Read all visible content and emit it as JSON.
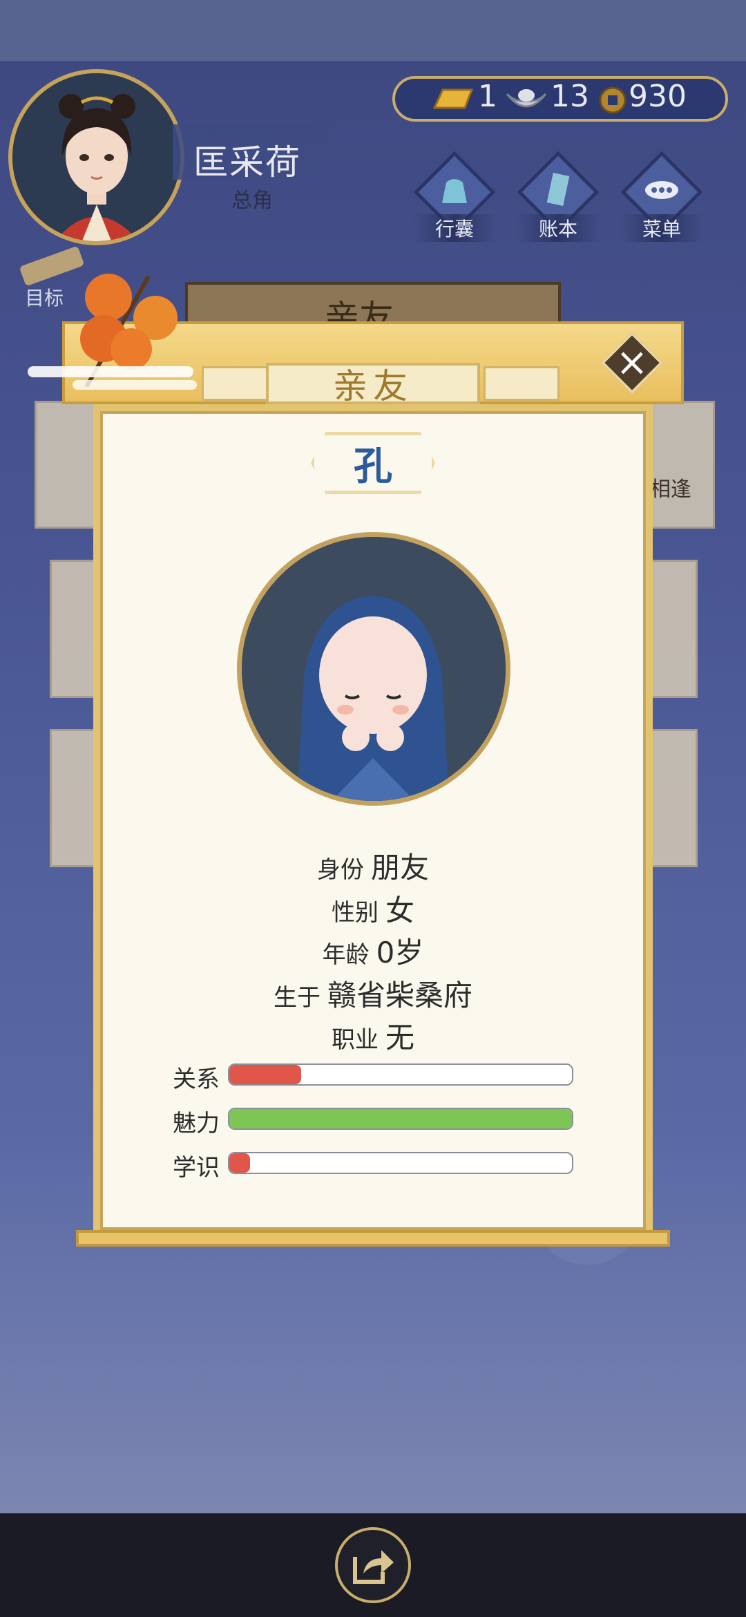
{
  "player": {
    "name": "匡采荷",
    "role": "总角"
  },
  "currency": {
    "gold": "1",
    "silver": "13",
    "coins": "930"
  },
  "menu": [
    {
      "label": "行囊",
      "icon": "bag-icon"
    },
    {
      "label": "账本",
      "icon": "ledger-icon"
    },
    {
      "label": "菜单",
      "icon": "more-icon"
    }
  ],
  "goal_label": "目标",
  "background_banner": "亲友",
  "background_card_text": "相逢",
  "modal": {
    "title": "亲友",
    "surname": "孔",
    "info": [
      {
        "key": "身份",
        "value": "朋友"
      },
      {
        "key": "性别",
        "value": "女"
      },
      {
        "key": "年龄",
        "value": "0岁"
      },
      {
        "key": "生于",
        "value": "赣省柴桑府"
      },
      {
        "key": "职业",
        "value": "无"
      }
    ],
    "stats": [
      {
        "label": "关系",
        "fraction": 0.21,
        "color": "#e0574a"
      },
      {
        "label": "魅力",
        "fraction": 1.0,
        "color": "#7dc653"
      },
      {
        "label": "学识",
        "fraction": 0.06,
        "color": "#e0574a"
      }
    ]
  },
  "colors": {
    "accent_gold": "#e2c36f",
    "panel_bg": "#fbf8ee",
    "surname_blue": "#2b5b9a"
  }
}
